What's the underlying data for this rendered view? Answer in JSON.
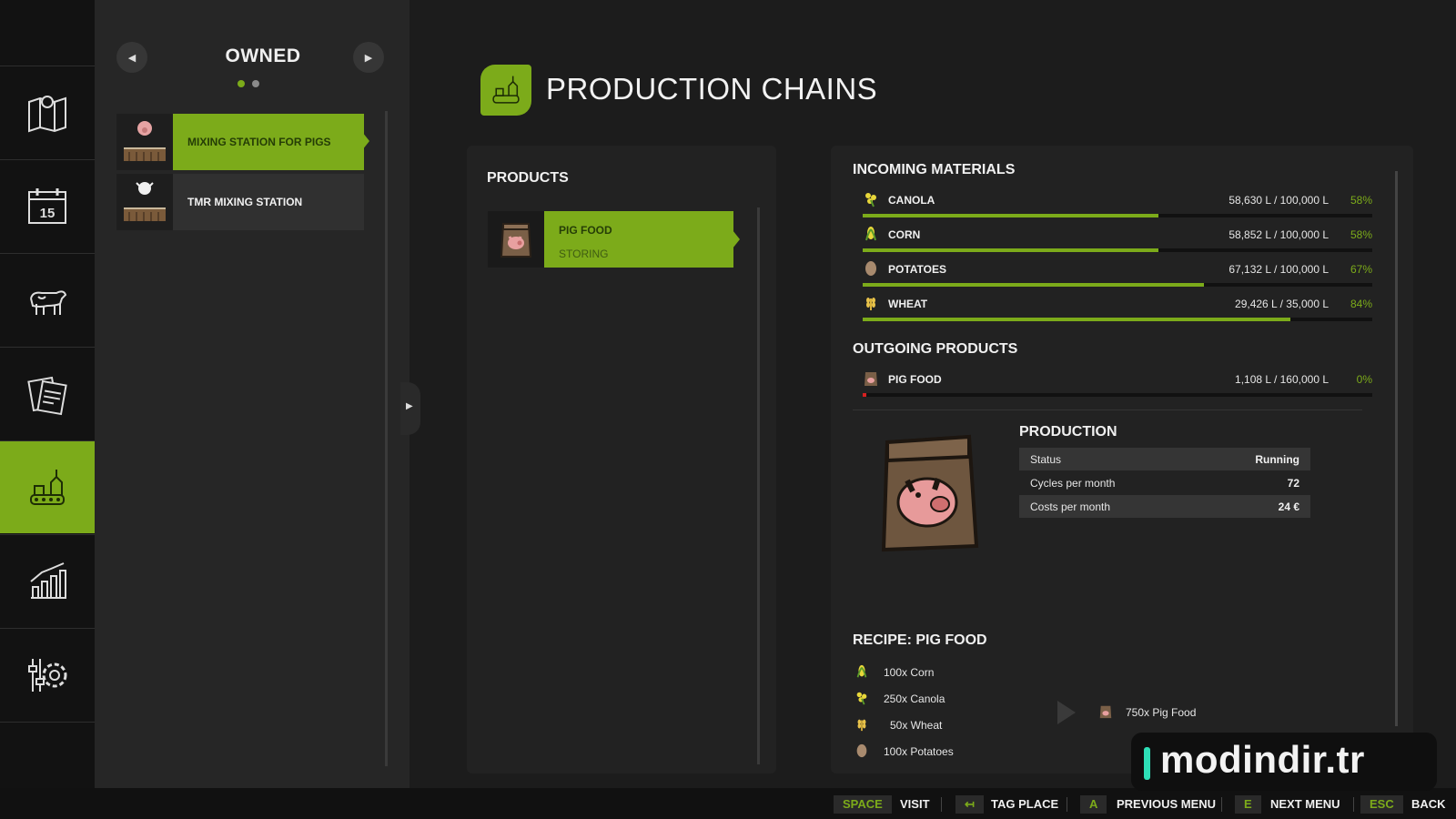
{
  "left_panel": {
    "title": "OWNED"
  },
  "stations": [
    {
      "label": "MIXING STATION FOR PIGS"
    },
    {
      "label": "TMR MIXING STATION"
    }
  ],
  "header": {
    "title": "PRODUCTION CHAINS"
  },
  "products": {
    "title": "PRODUCTS",
    "selected": {
      "name": "PIG FOOD",
      "status": "STORING"
    }
  },
  "incoming": {
    "title": "INCOMING MATERIALS",
    "items": [
      {
        "name": "CANOLA",
        "amount": "58,630 L / 100,000 L",
        "pct": "58%",
        "fill": 0.58
      },
      {
        "name": "CORN",
        "amount": "58,852 L / 100,000 L",
        "pct": "58%",
        "fill": 0.58
      },
      {
        "name": "POTATOES",
        "amount": "67,132 L / 100,000 L",
        "pct": "67%",
        "fill": 0.67
      },
      {
        "name": "WHEAT",
        "amount": "29,426 L / 35,000 L",
        "pct": "84%",
        "fill": 0.84
      }
    ]
  },
  "outgoing": {
    "title": "OUTGOING PRODUCTS",
    "items": [
      {
        "name": "PIG FOOD",
        "amount": "1,108 L / 160,000 L",
        "pct": "0%",
        "fill": 0.007
      }
    ]
  },
  "production": {
    "title": "PRODUCTION",
    "rows": [
      {
        "key": "Status",
        "value": "Running"
      },
      {
        "key": "Cycles per month",
        "value": "72"
      },
      {
        "key": "Costs per month",
        "value": "24 €"
      }
    ]
  },
  "recipe": {
    "title": "RECIPE: PIG FOOD",
    "inputs": [
      "100x Corn",
      "250x Canola",
      "50x Wheat",
      "100x Potatoes"
    ],
    "output": "750x Pig Food"
  },
  "bottom_bar": {
    "space_key": "SPACE",
    "space_label": "VISIT",
    "tag_key": "↤",
    "tag_label": "TAG PLACE",
    "a_key": "A",
    "a_label": "PREVIOUS MENU",
    "e_key": "E",
    "e_label": "NEXT MENU",
    "esc_key": "ESC",
    "esc_label": "BACK"
  },
  "watermark": {
    "text": "modindir.tr"
  },
  "colors": {
    "accent": "#7cab1a",
    "background": "#1c1c1c",
    "panel": "#262626"
  },
  "icons": {
    "nav": [
      "map-icon",
      "calendar-icon",
      "cow-icon",
      "contracts-icon",
      "production-icon",
      "statistics-icon",
      "settings-icon"
    ]
  }
}
